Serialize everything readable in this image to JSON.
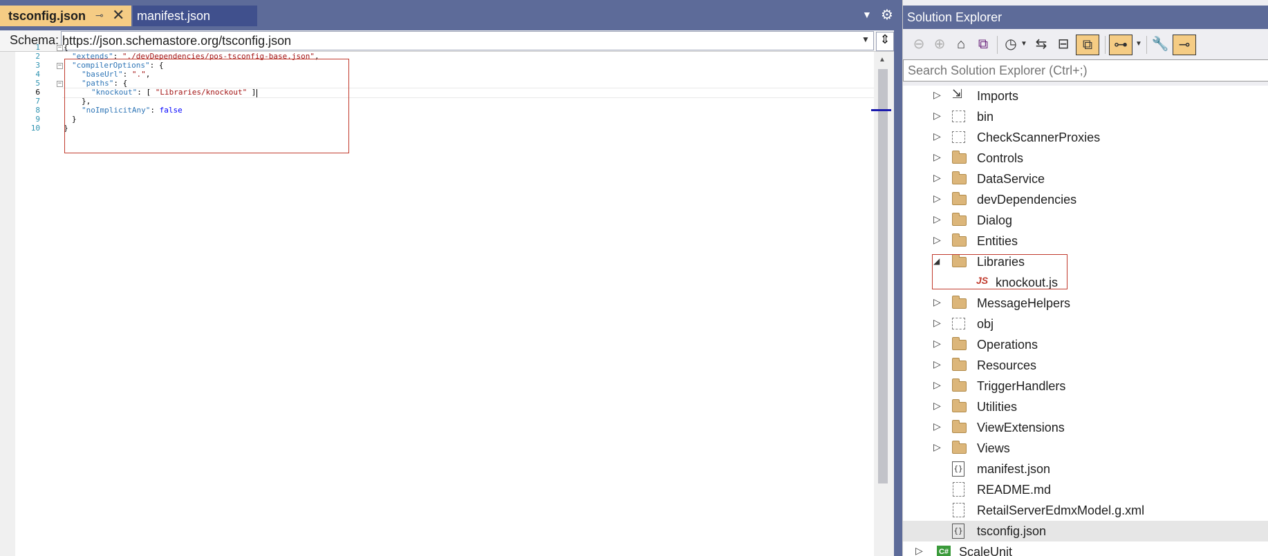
{
  "editor": {
    "tabs": [
      {
        "label": "tsconfig.json",
        "active": true
      },
      {
        "label": "manifest.json",
        "active": false
      }
    ],
    "schema_label": "Schema:",
    "schema_url": "https://json.schemastore.org/tsconfig.json",
    "line_numbers": [
      "1",
      "2",
      "3",
      "4",
      "5",
      "6",
      "7",
      "8",
      "9",
      "10"
    ],
    "current_line": "6",
    "code": {
      "l1": "{",
      "l2_key": "\"extends\"",
      "l2_sep": ": ",
      "l2_val": "\"./devDependencies/pos-tsconfig-base.json\"",
      "l2_end": ",",
      "l3_key": "\"compilerOptions\"",
      "l3_rest": ": {",
      "l4_key": "\"baseUrl\"",
      "l4_sep": ": ",
      "l4_val": "\".\"",
      "l4_end": ",",
      "l5_key": "\"paths\"",
      "l5_rest": ": {",
      "l6_key": "\"knockout\"",
      "l6_sep": ": [ ",
      "l6_val": "\"Libraries/knockout\"",
      "l6_end": " ]",
      "l7": "},",
      "l8_key": "\"noImplicitAny\"",
      "l8_sep": ": ",
      "l8_val": "false",
      "l9": "}",
      "l10": "}"
    }
  },
  "solution_explorer": {
    "title": "Solution Explorer",
    "search_placeholder": "Search Solution Explorer (Ctrl+;)",
    "items": [
      {
        "label": "Imports",
        "icon": "imports-icon",
        "expander": "collapsed"
      },
      {
        "label": "bin",
        "icon": "dotted-folder-icon",
        "expander": "collapsed"
      },
      {
        "label": "CheckScannerProxies",
        "icon": "dotted-folder-icon",
        "expander": "collapsed"
      },
      {
        "label": "Controls",
        "icon": "folder-icon",
        "expander": "collapsed"
      },
      {
        "label": "DataService",
        "icon": "folder-icon",
        "expander": "collapsed"
      },
      {
        "label": "devDependencies",
        "icon": "folder-icon",
        "expander": "collapsed"
      },
      {
        "label": "Dialog",
        "icon": "folder-icon",
        "expander": "collapsed"
      },
      {
        "label": "Entities",
        "icon": "folder-icon",
        "expander": "collapsed"
      },
      {
        "label": "Libraries",
        "icon": "folder-icon",
        "expander": "expanded"
      },
      {
        "label": "knockout.js",
        "icon": "js-icon",
        "expander": "none"
      },
      {
        "label": "MessageHelpers",
        "icon": "folder-icon",
        "expander": "collapsed"
      },
      {
        "label": "obj",
        "icon": "dotted-folder-icon",
        "expander": "collapsed"
      },
      {
        "label": "Operations",
        "icon": "folder-icon",
        "expander": "collapsed"
      },
      {
        "label": "Resources",
        "icon": "folder-icon",
        "expander": "collapsed"
      },
      {
        "label": "TriggerHandlers",
        "icon": "folder-icon",
        "expander": "collapsed"
      },
      {
        "label": "Utilities",
        "icon": "folder-icon",
        "expander": "collapsed"
      },
      {
        "label": "ViewExtensions",
        "icon": "folder-icon",
        "expander": "collapsed"
      },
      {
        "label": "Views",
        "icon": "folder-icon",
        "expander": "collapsed"
      },
      {
        "label": "manifest.json",
        "icon": "json-file-icon",
        "expander": "none"
      },
      {
        "label": "README.md",
        "icon": "dotted-file-icon",
        "expander": "none"
      },
      {
        "label": "RetailServerEdmxModel.g.xml",
        "icon": "dotted-file-icon",
        "expander": "none"
      },
      {
        "label": "tsconfig.json",
        "icon": "json-file-icon",
        "expander": "none",
        "selected": true
      },
      {
        "label": "ScaleUnit",
        "icon": "csharp-project-icon",
        "expander": "collapsed"
      }
    ],
    "js_badge": "JS",
    "json_badge": "{}",
    "csharp_badge": "C#"
  },
  "colors": {
    "theme_blue": "#5d6b99",
    "active_tab": "#f5cc84",
    "highlight_box": "#c0392b",
    "json_key": "#2e75b6",
    "json_string": "#a31515",
    "json_keyword": "#0000ff"
  }
}
